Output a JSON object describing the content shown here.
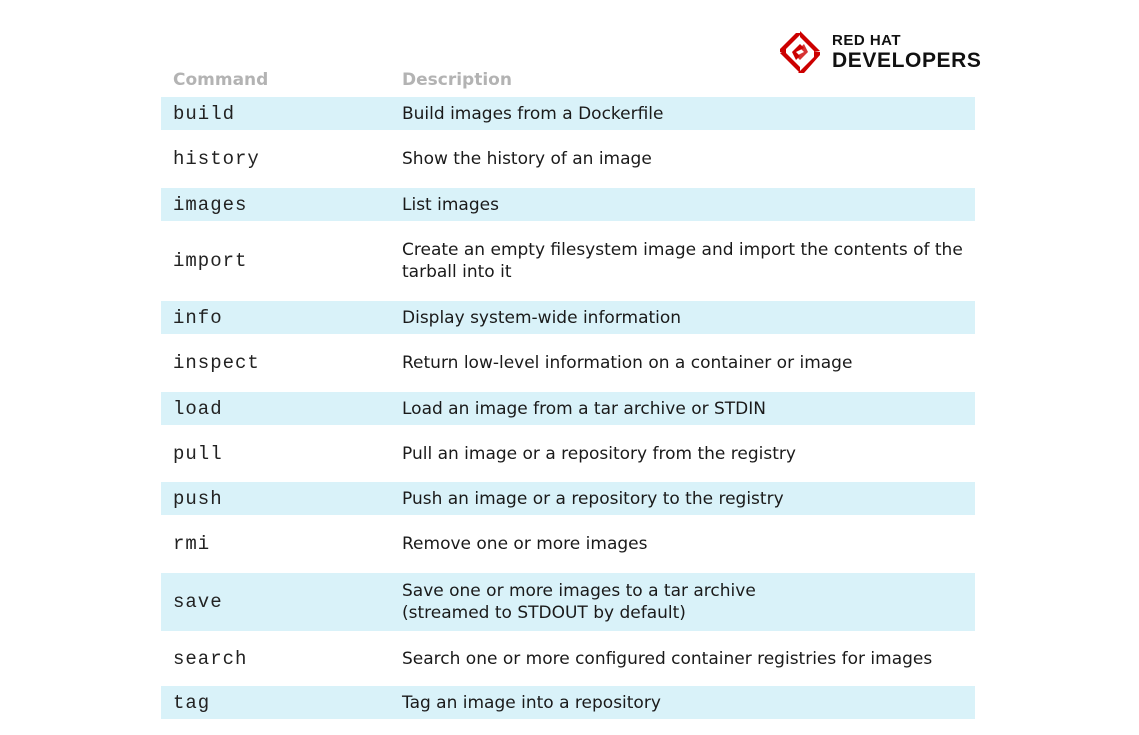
{
  "logo": {
    "line1": "RED HAT",
    "line2": "DEVELOPERS",
    "color": "#cc0000"
  },
  "header": {
    "command": "Command",
    "description": "Description"
  },
  "rows": [
    {
      "command": "build",
      "description": "Build images from a Dockerfile"
    },
    {
      "command": "history",
      "description": "Show the history of an image"
    },
    {
      "command": "images",
      "description": "List images"
    },
    {
      "command": "import",
      "description": "Create an empty filesystem image and import the contents of the\ntarball into it"
    },
    {
      "command": "info",
      "description": "Display system-wide information"
    },
    {
      "command": "inspect",
      "description": "Return low-level information on a container or image"
    },
    {
      "command": "load",
      "description": "Load an image from a tar archive or STDIN"
    },
    {
      "command": "pull",
      "description": "Pull an image or a repository from the registry"
    },
    {
      "command": "push",
      "description": "Push an image or a repository to the registry"
    },
    {
      "command": "rmi",
      "description": "Remove one or more images"
    },
    {
      "command": "save",
      "description": "Save one or more images to a tar archive\n(streamed to STDOUT by default)"
    },
    {
      "command": "search",
      "description": "Search one or more configured container registries for images"
    },
    {
      "command": "tag",
      "description": "Tag an image into a repository"
    }
  ]
}
